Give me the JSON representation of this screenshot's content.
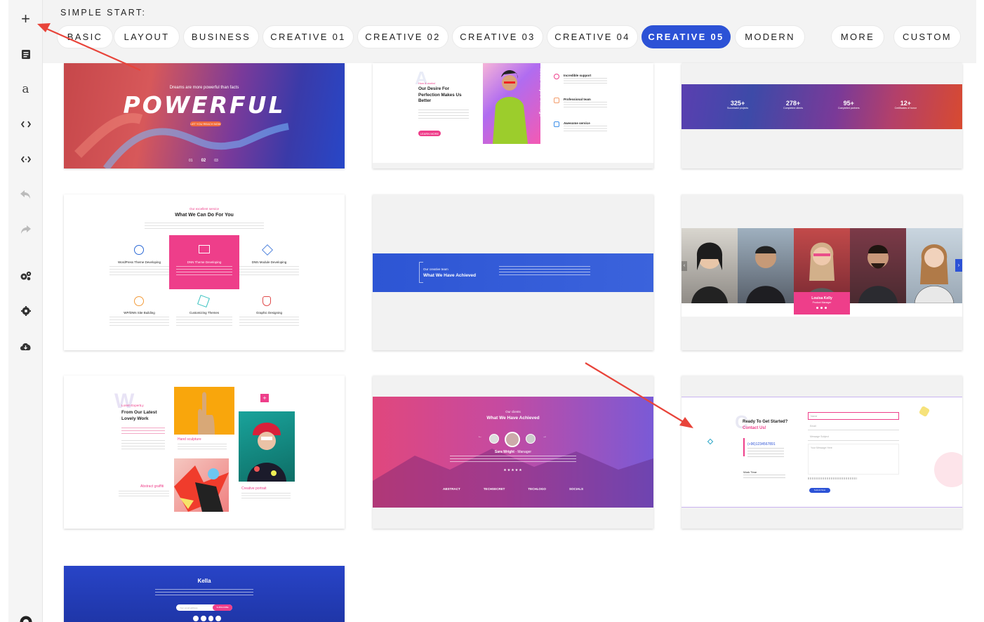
{
  "toolbar": {
    "add_icon": "+",
    "pages_icon": "pages-icon",
    "text_icon": "a",
    "code_icon": "<>",
    "code2_icon": "<·>",
    "undo_icon": "undo-icon",
    "redo_icon": "redo-icon",
    "settings_multi_icon": "cogs-icon",
    "settings_icon": "gear-icon",
    "download_icon": "cloud-download-icon",
    "help_icon": "help-icon"
  },
  "topbar": {
    "label": "SIMPLE START:",
    "categories": [
      "BASIC",
      "LAYOUT",
      "BUSINESS",
      "CREATIVE 01",
      "CREATIVE 02",
      "CREATIVE 03",
      "CREATIVE 04",
      "CREATIVE 05",
      "MODERN",
      "MORE",
      "CUSTOM"
    ],
    "active": "CREATIVE 05"
  },
  "cards": {
    "hero": {
      "tagline": "Dreams are more powerful than facts",
      "title": "POWERFUL",
      "button": "LET YOU REACH NOW",
      "pager": [
        "01",
        "02",
        "03"
      ]
    },
    "about": {
      "letter": "A",
      "small": "How & works!",
      "title": "Our Desire For Perfection Makes Us Better",
      "button": "LEARN MORE",
      "vertical": "Ideas inspire change",
      "features": [
        "Incredible support",
        "Professional team",
        "Awesome service"
      ]
    },
    "stats": {
      "values": [
        "325+",
        "278+",
        "95+",
        "12+"
      ],
      "labels": [
        "Successful projects",
        "Completed clients",
        "Completed partners",
        "Certificates of honor"
      ]
    },
    "services": {
      "kicker": "Our excellent service",
      "title": "What We Can Do For You",
      "items": [
        "WordPress Theme Developing",
        "DNN Theme Developing",
        "DNN Module Developing",
        "WP/DNN Site Building",
        "Customizing Themes",
        "Graphic Designing"
      ]
    },
    "achieved": {
      "kicker": "Our creative team",
      "title": "What We Have Achieved"
    },
    "team": {
      "name": "Louisa Kelly",
      "role": "Product Manager"
    },
    "portfolio": {
      "letter": "W",
      "kicker": "Lorem ExpertLy",
      "title": "From Our Latest Lovely Work",
      "items": [
        "Hand sculpture",
        "Abstract graffiti",
        "Creative portrait"
      ]
    },
    "clients": {
      "kicker": "Our clients",
      "title": "What We Have Achieved",
      "name": "Sara Wright",
      "role": "Manager",
      "logos": [
        "ABSTRACT",
        "TECHSECRET",
        "TECHLOGO",
        "SOCIALS"
      ]
    },
    "contact": {
      "letter": "C",
      "title": "Ready To Get Started?",
      "subtitle": "Contact Us!",
      "phone": "(+96)1234567891",
      "fields": [
        "Name",
        "Email",
        "Message Subject",
        "Your Message Here"
      ],
      "work": "Work Time",
      "button": "Submit Now"
    },
    "kella": {
      "title": "Kella",
      "input": "Your email address",
      "button": "SUBSCRIBE"
    }
  },
  "colors": {
    "accent": "#2c52d6",
    "pink": "#ee3e8a",
    "arrow": "#e8443a"
  }
}
